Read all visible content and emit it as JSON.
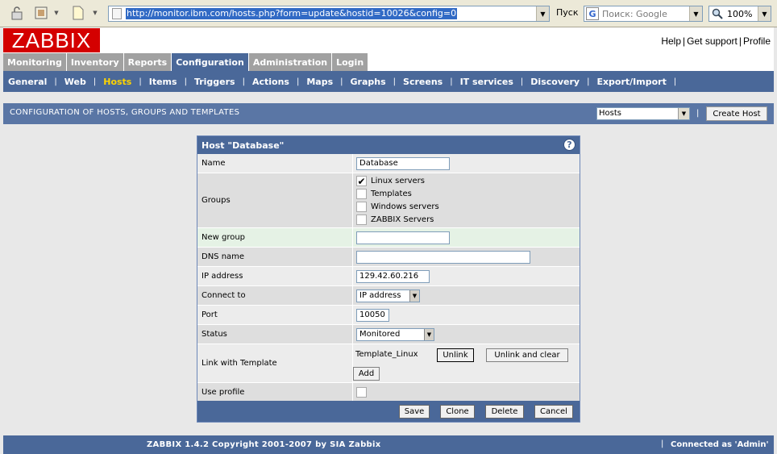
{
  "browser": {
    "url": "http://monitor.ibm.com/hosts.php?form=update&hostid=10026&config=0",
    "go_label": "Пуск",
    "search_placeholder": "Поиск: Google",
    "search_logo": "G",
    "zoom": "100%"
  },
  "header": {
    "logo": "ZABBIX",
    "links": [
      "Help",
      "Get support",
      "Profile"
    ]
  },
  "main_tabs": [
    {
      "label": "Monitoring",
      "active": false
    },
    {
      "label": "Inventory",
      "active": false
    },
    {
      "label": "Reports",
      "active": false
    },
    {
      "label": "Configuration",
      "active": true
    },
    {
      "label": "Administration",
      "active": false
    },
    {
      "label": "Login",
      "active": false
    }
  ],
  "sub_nav": [
    {
      "label": "General",
      "active": false
    },
    {
      "label": "Web",
      "active": false
    },
    {
      "label": "Hosts",
      "active": true
    },
    {
      "label": "Items",
      "active": false
    },
    {
      "label": "Triggers",
      "active": false
    },
    {
      "label": "Actions",
      "active": false
    },
    {
      "label": "Maps",
      "active": false
    },
    {
      "label": "Graphs",
      "active": false
    },
    {
      "label": "Screens",
      "active": false
    },
    {
      "label": "IT services",
      "active": false
    },
    {
      "label": "Discovery",
      "active": false
    },
    {
      "label": "Export/Import",
      "active": false
    }
  ],
  "title_bar": {
    "title": "CONFIGURATION OF HOSTS, GROUPS AND TEMPLATES",
    "select_value": "Hosts",
    "separator": "|",
    "create_button": "Create Host"
  },
  "form": {
    "title": "Host \"Database\"",
    "help_icon": "?",
    "name_label": "Name",
    "name_value": "Database",
    "groups_label": "Groups",
    "groups": [
      {
        "label": "Linux servers",
        "checked": true
      },
      {
        "label": "Templates",
        "checked": false
      },
      {
        "label": "Windows servers",
        "checked": false
      },
      {
        "label": "ZABBIX Servers",
        "checked": false
      }
    ],
    "new_group_label": "New group",
    "new_group_value": "",
    "dns_label": "DNS name",
    "dns_value": "",
    "ip_label": "IP address",
    "ip_value": "129.42.60.216",
    "connect_label": "Connect to",
    "connect_value": "IP address",
    "port_label": "Port",
    "port_value": "10050",
    "status_label": "Status",
    "status_value": "Monitored",
    "link_label": "Link with Template",
    "template_name": "Template_Linux",
    "unlink_button": "Unlink",
    "unlink_clear_button": "Unlink and clear",
    "add_button": "Add",
    "profile_label": "Use profile",
    "profile_checked": false,
    "buttons": {
      "save": "Save",
      "clone": "Clone",
      "delete": "Delete",
      "cancel": "Cancel"
    }
  },
  "footer": {
    "copyright": "ZABBIX 1.4.2 Copyright 2001-2007 by  SIA Zabbix",
    "separator": "|",
    "connected": "Connected as 'Admin'"
  }
}
